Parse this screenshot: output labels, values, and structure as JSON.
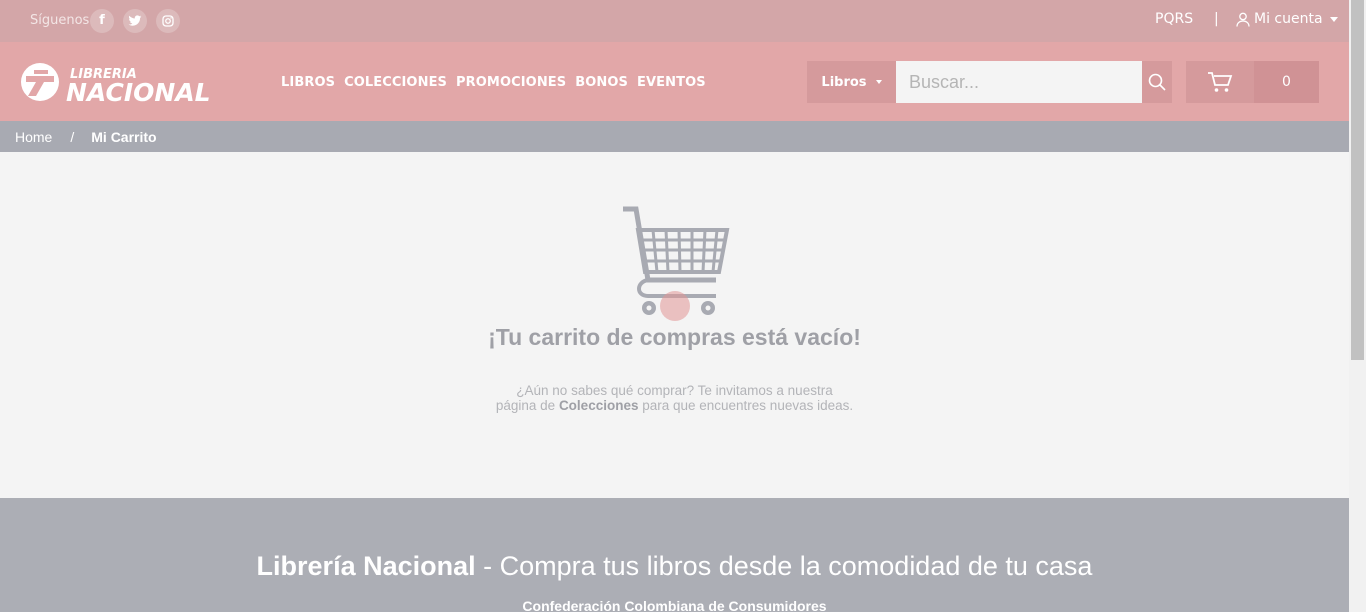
{
  "topbar": {
    "follow_label": "Síguenos",
    "social": [
      "f",
      "t",
      "ig"
    ],
    "pqrs": "PQRS",
    "separator": "|",
    "account_label": "Mi cuenta"
  },
  "header": {
    "brand_top": "LIBRERIA",
    "brand_bottom": "NACIONAL",
    "nav": [
      "LIBROS",
      "COLECCIONES",
      "PROMOCIONES",
      "BONOS",
      "EVENTOS"
    ],
    "search_category": "Libros",
    "search_placeholder": "Buscar...",
    "cart_count": "0"
  },
  "breadcrumb": {
    "home": "Home",
    "separator": "/",
    "current": "Mi Carrito"
  },
  "main": {
    "title": "¡Tu carrito de compras está vacío!",
    "line1": "¿Aún no sabes qué comprar? Te invitamos a nuestra",
    "line2_pre": "página de ",
    "line2_link": "Colecciones",
    "line2_post": " para que encuentres nuevas ideas."
  },
  "footer": {
    "brand": "Librería Nacional",
    "tagline": " - Compra tus libros desde la comodidad de tu casa",
    "subtitle": "Confederación Colombiana de Consumidores"
  },
  "colors": {
    "topbar_bg": "#d3a6a8",
    "header_bg": "#e2a7a8",
    "breadcrumb_bg": "#a8aab2",
    "footer_bg": "#acaeb5"
  }
}
